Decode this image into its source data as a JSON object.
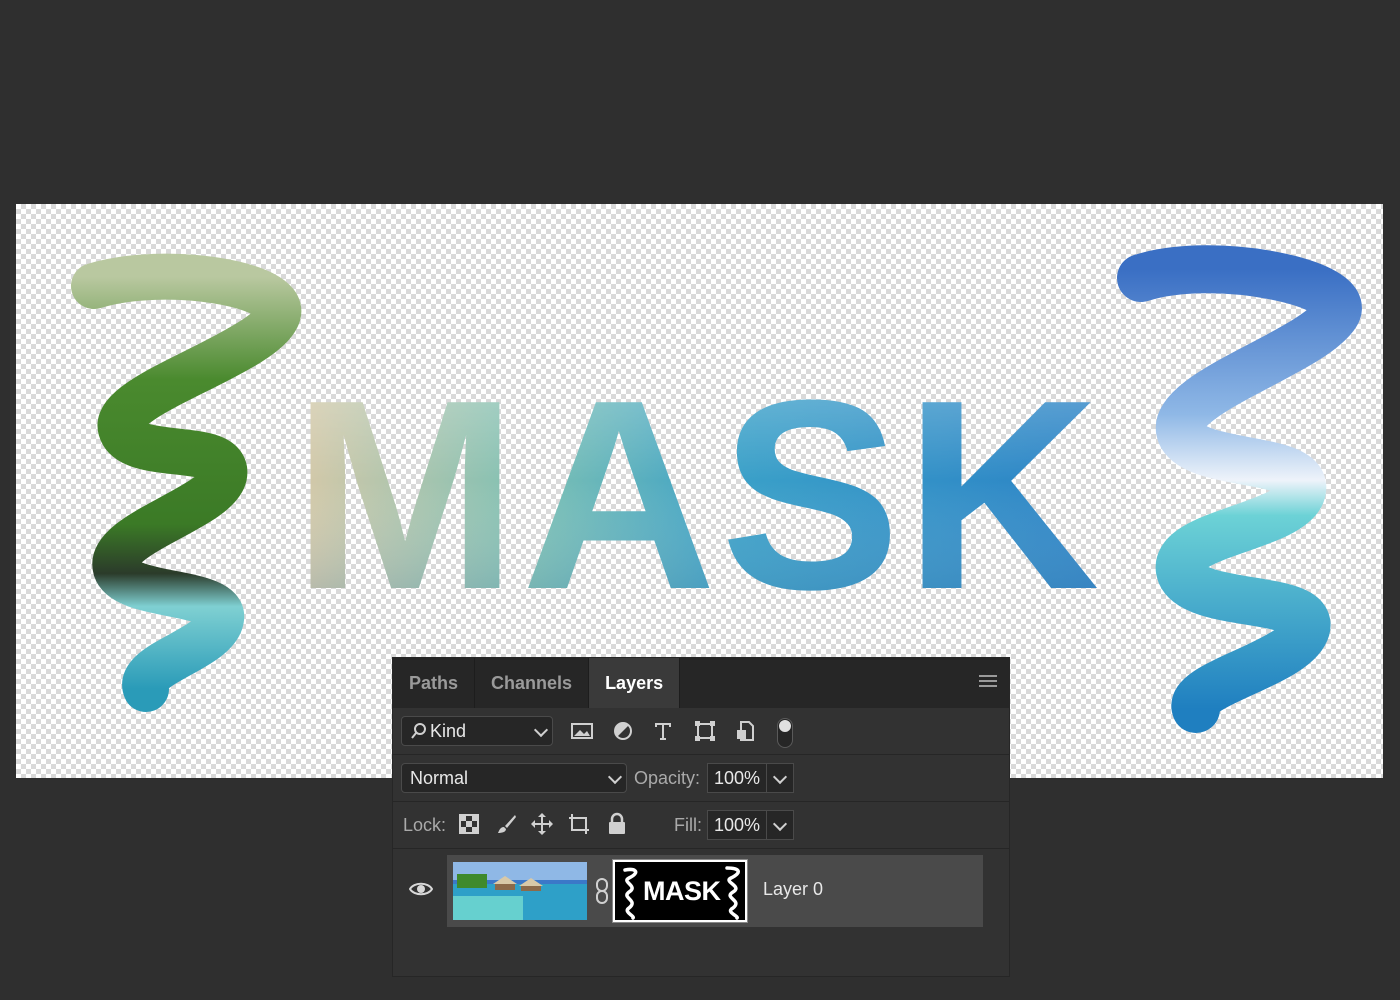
{
  "canvas": {
    "artwork_text": "MASK",
    "photo_colors": {
      "sky_top": "#3a6fc4",
      "sky_mid": "#8fb8e6",
      "cloud": "#eef3fa",
      "water_light": "#6cd2d6",
      "water_deep": "#1f7fc0",
      "foliage": "#3f8a2c",
      "thatch": "#d8c9a8"
    }
  },
  "panel": {
    "tabs": [
      {
        "label": "Paths",
        "active": false
      },
      {
        "label": "Channels",
        "active": false
      },
      {
        "label": "Layers",
        "active": true
      }
    ],
    "menu_icon": "panel-menu-icon",
    "filter": {
      "kind_label": "Kind",
      "kind_icon": "search-icon",
      "filter_icons": [
        "image-filter-icon",
        "adjustment-filter-icon",
        "type-filter-icon",
        "shape-filter-icon",
        "smart-object-filter-icon",
        "filter-toggle-icon"
      ]
    },
    "blend": {
      "mode": "Normal",
      "opacity_label": "Opacity:",
      "opacity_value": "100%"
    },
    "lock": {
      "label": "Lock:",
      "icons": [
        "lock-transparent-pixels-icon",
        "lock-image-pixels-icon",
        "lock-position-icon",
        "lock-artboard-icon",
        "lock-all-icon"
      ],
      "fill_label": "Fill:",
      "fill_value": "100%"
    },
    "layer": {
      "visible": true,
      "name": "Layer 0",
      "mask_thumbnail_text": "MASK"
    }
  }
}
